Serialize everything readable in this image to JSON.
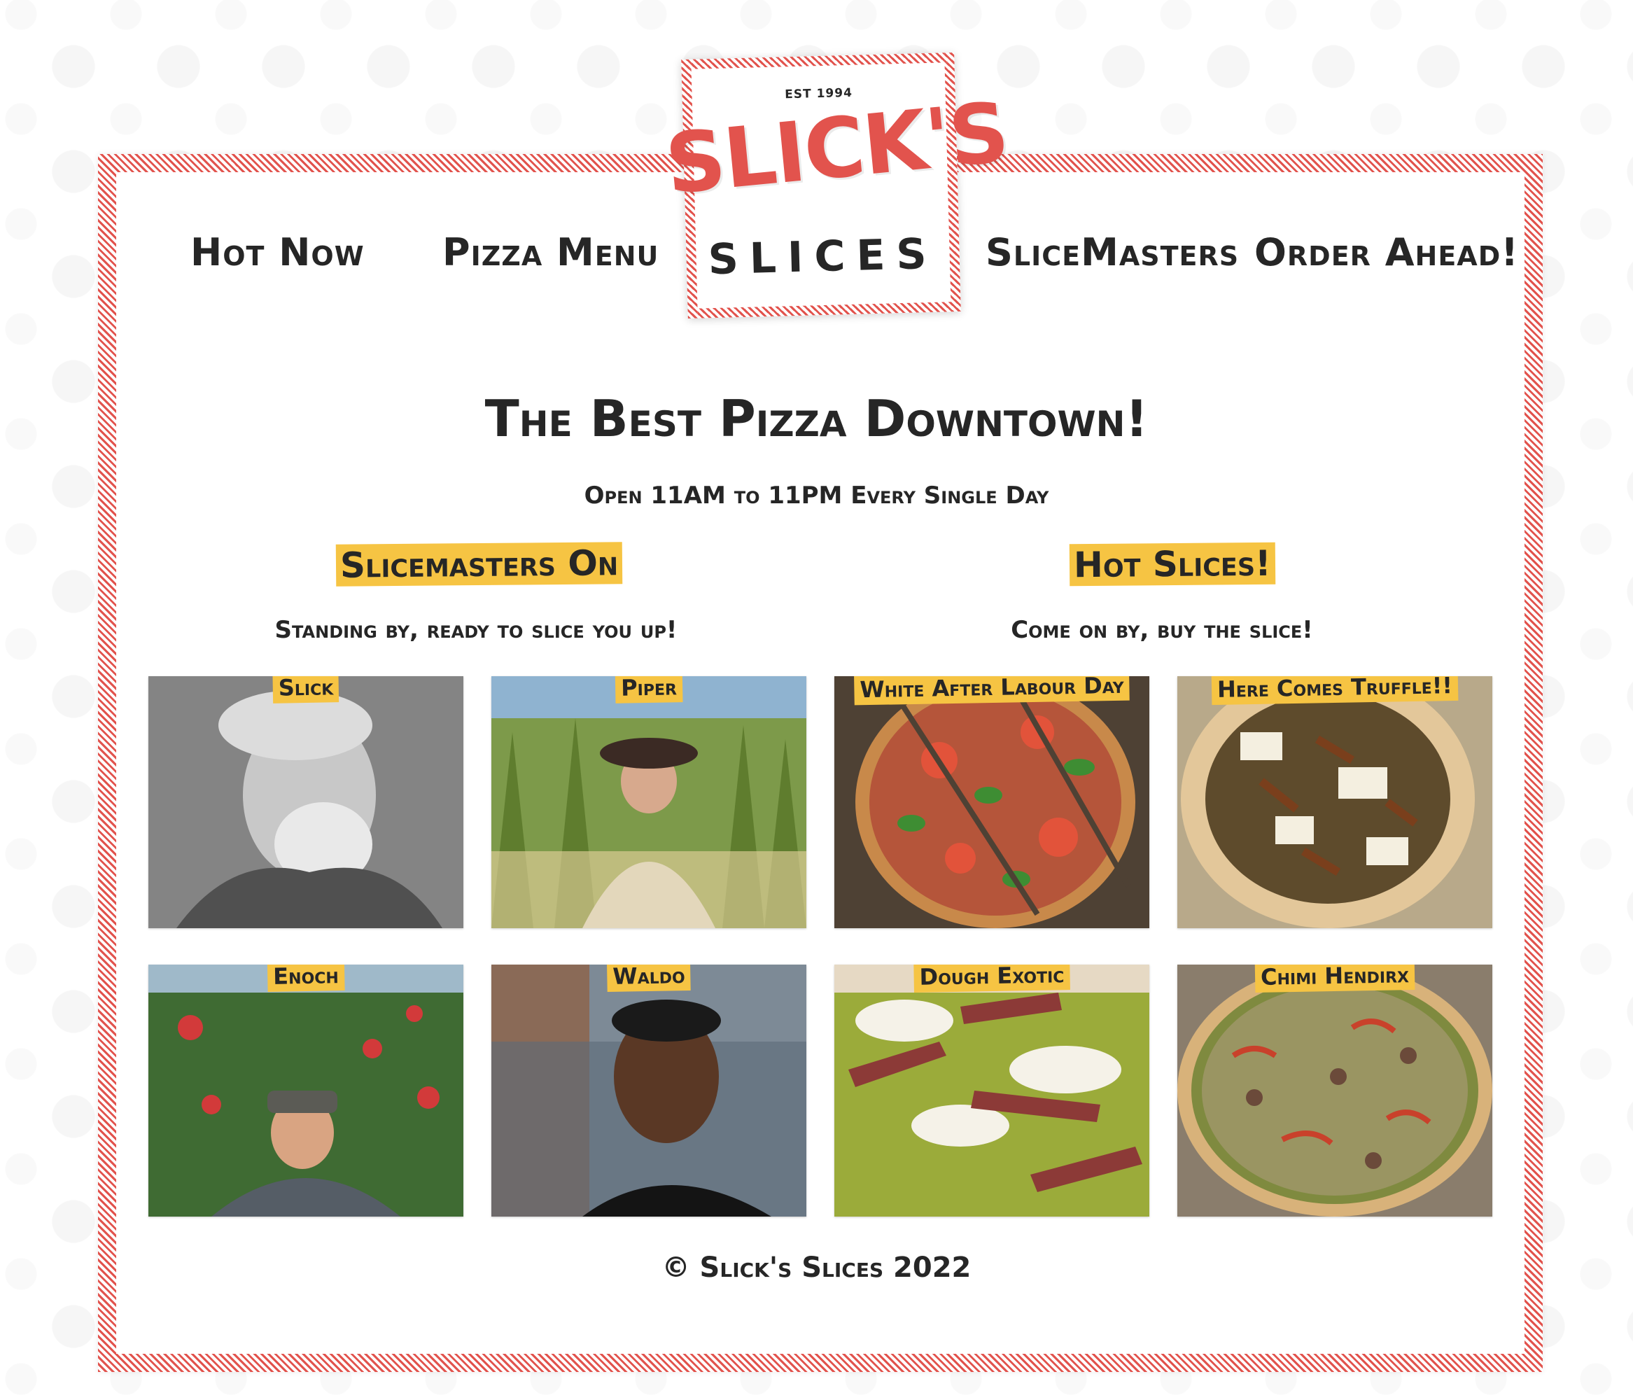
{
  "nav": {
    "hot_now": "Hot Now",
    "pizza_menu": "Pizza Menu",
    "slicemasters": "SliceMasters",
    "order_ahead": "Order Ahead!"
  },
  "logo": {
    "est": "EST 1994",
    "big": "SLICK'S",
    "small": "SLICES"
  },
  "hero": {
    "title": "The Best Pizza Downtown!",
    "subtitle": "Open 11AM to 11PM Every Single Day"
  },
  "slicemasters_section": {
    "heading": "Slicemasters On",
    "subheading": "Standing by, ready to slice you up!",
    "people": [
      {
        "name": "Slick"
      },
      {
        "name": "Piper"
      },
      {
        "name": "Enoch"
      },
      {
        "name": "Waldo"
      }
    ]
  },
  "hot_slices_section": {
    "heading": "Hot Slices!",
    "subheading": "Come on by, buy the slice!",
    "pizzas": [
      {
        "name": "White After Labour Day"
      },
      {
        "name": "Here Comes Truffle!!"
      },
      {
        "name": "Dough Exotic"
      },
      {
        "name": "Chimi Hendirx"
      }
    ]
  },
  "footer": {
    "text": "© Slick's Slices 2022"
  },
  "colors": {
    "accent_red": "#e2534d",
    "highlight_yellow": "#f6c443",
    "text": "#262626"
  }
}
